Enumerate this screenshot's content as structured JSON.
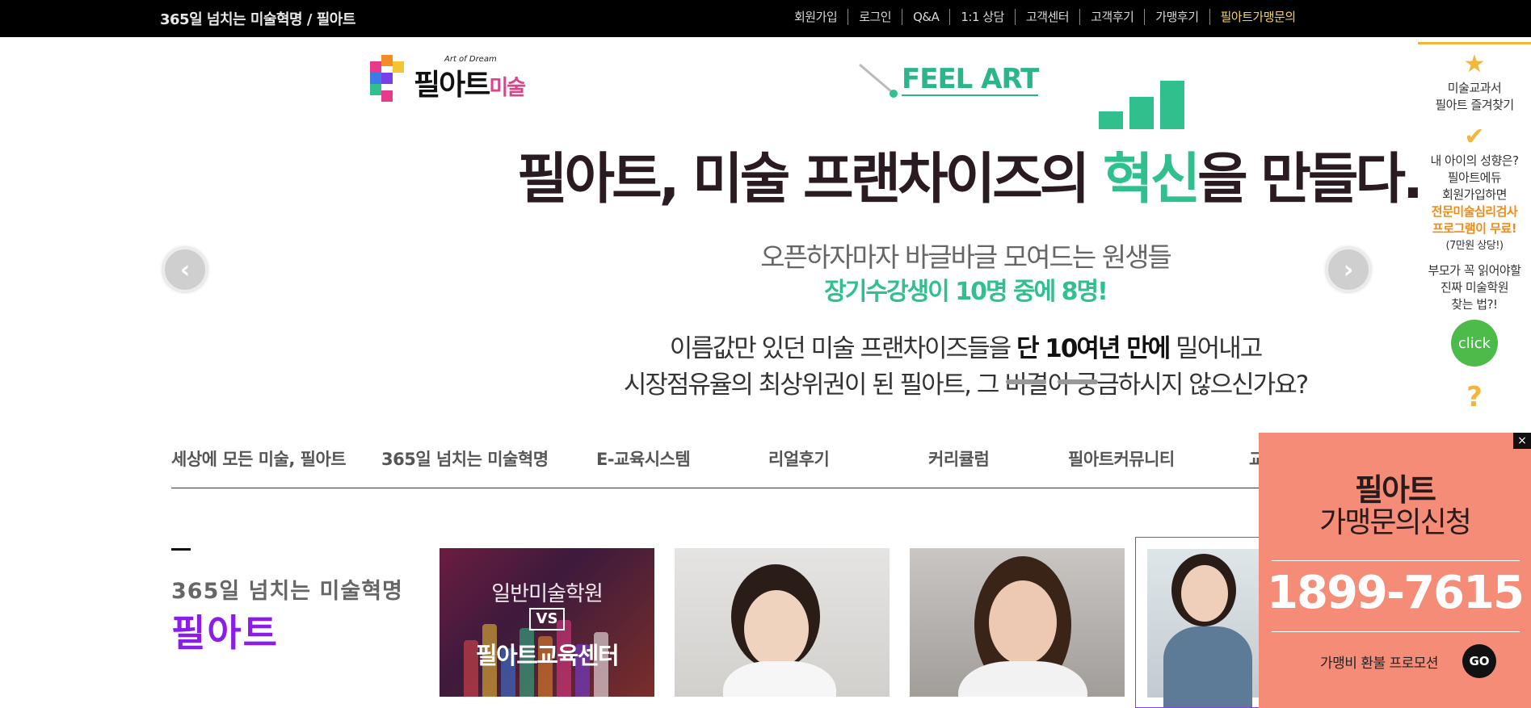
{
  "topbar": {
    "slogan": "365일 넘치는 미술혁명 / 필아트",
    "links": [
      "회원가입",
      "로그인",
      "Q&A",
      "1:1 상담",
      "고객센터",
      "고객후기",
      "가맹후기",
      "필아트가맹문의"
    ]
  },
  "logo": {
    "sub": "Art of Dream",
    "main_a": "필아트",
    "main_b": "미술"
  },
  "hero": {
    "tag": "FEEL ART",
    "headline_pre": "필아트, 미술 프랜차이즈의 ",
    "headline_acc": "혁신",
    "headline_post": "을 만들다.",
    "line1": "오픈하자마자 바글바글 모여드는 원생들",
    "line2": "장기수강생이 10명 중에 8명!",
    "line3_pre": "이름값만 있던 미술 프랜차이즈들을 ",
    "line3_bold": "단 10여년 만에",
    "line3_post": " 밀어내고",
    "line4": "시장점유율의 최상위권이 된 필아트, 그 비결이 궁금하시지 않으신가요?",
    "prev_icon": "chevron-left-icon",
    "next_icon": "chevron-right-icon"
  },
  "quickbar": {
    "item1": [
      "미술교과서",
      "필아트 즐겨찾기"
    ],
    "item2": [
      "내 아이의 성향은?",
      "필아트에듀",
      "회원가입하면"
    ],
    "item2_hl": [
      "전문미술심리검사",
      "프로그램이 무료!"
    ],
    "item2_small": "(7만원 상당!)",
    "item3": [
      "부모가 꼭 읽어야할",
      "진짜 미술학원",
      "찾는 법?!"
    ],
    "click": "click"
  },
  "mainnav": {
    "brand": "세상에 모든 미술, 필아트",
    "items": [
      "365일 넘치는 미술혁명",
      "E-교육시스템",
      "리얼후기",
      "커리큘럼",
      "필아트커뮤니티",
      "교"
    ]
  },
  "section": {
    "subtitle": "365일 넘치는 미술혁명",
    "title": "필아트"
  },
  "cards": {
    "card1_top": "일반미술학원",
    "card1_vs": "VS",
    "card1_bottom": "필아트교육센터"
  },
  "promo": {
    "title1": "필아트",
    "title2": "가맹문의신청",
    "phone": "1899-7615",
    "footer": "가맹비 환불 프로모션",
    "go": "GO",
    "close": "×"
  },
  "colors": {
    "accent_green": "#2fc08d",
    "accent_purple": "#8a1ee8",
    "promo_bg": "#f58c78",
    "topbar_highlight": "#f3d35b"
  }
}
